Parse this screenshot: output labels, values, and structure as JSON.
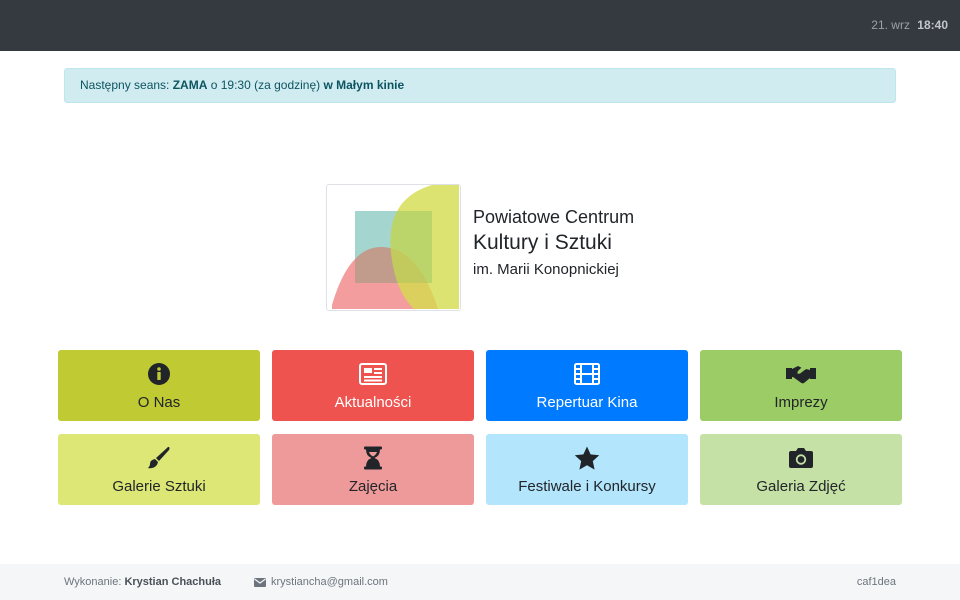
{
  "header": {
    "date": "21. wrz",
    "time": "18:40"
  },
  "alert": {
    "prefix": "Następny seans: ",
    "movie": "ZAMA",
    "middle": " o 19:30 (za godzinę) ",
    "venue": "w Małym kinie"
  },
  "institution": {
    "line1": "Powiatowe Centrum",
    "line2": "Kultury i Sztuki",
    "line3": "im. Marii Konopnickiej"
  },
  "tiles": [
    {
      "label": "O Nas",
      "icon": "info-circle-icon",
      "bg": "#c0ca33",
      "fg": "#212529"
    },
    {
      "label": "Aktualności",
      "icon": "newspaper-icon",
      "bg": "#ef5350",
      "fg": "#ffffff"
    },
    {
      "label": "Repertuar Kina",
      "icon": "film-icon",
      "bg": "#007bff",
      "fg": "#ffffff"
    },
    {
      "label": "Imprezy",
      "icon": "handshake-icon",
      "bg": "#9ccc65",
      "fg": "#212529"
    },
    {
      "label": "Galerie Sztuki",
      "icon": "paint-brush-icon",
      "bg": "#dce775",
      "fg": "#212529"
    },
    {
      "label": "Zajęcia",
      "icon": "hourglass-icon",
      "bg": "#ef9a9a",
      "fg": "#212529"
    },
    {
      "label": "Festiwale i Konkursy",
      "icon": "star-icon",
      "bg": "#b3e5fc",
      "fg": "#212529"
    },
    {
      "label": "Galeria Zdjęć",
      "icon": "camera-icon",
      "bg": "#c5e1a5",
      "fg": "#212529"
    }
  ],
  "footer": {
    "credit_prefix": "Wykonanie: ",
    "credit_name": "Krystian Chachuła",
    "email": "krystiancha@gmail.com",
    "version": "caf1dea"
  }
}
